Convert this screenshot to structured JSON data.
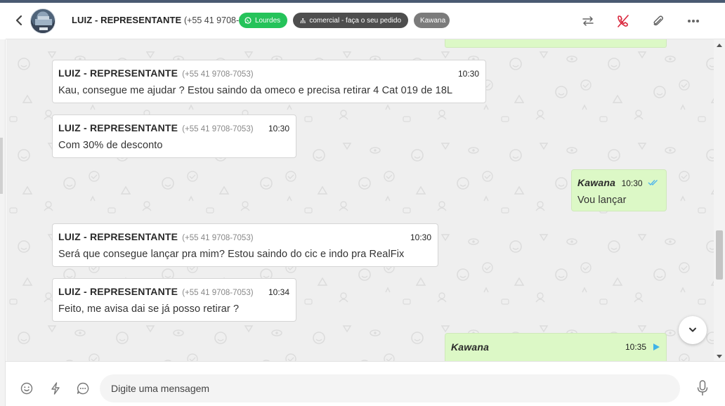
{
  "header": {
    "contact_name": "LUIZ - REPRESENTANTE",
    "contact_phone": "(+55 41 9708-7053)",
    "tags": [
      {
        "label": "Lourdes",
        "color": "#25c35a",
        "icon": "whatsapp-icon"
      },
      {
        "label": "comercial - faça o seu pedido",
        "color": "#4e4e4e",
        "icon": "sitemap-icon"
      },
      {
        "label": "Kawana",
        "color": "#7b7b7b"
      }
    ],
    "actions": [
      "transfer-icon",
      "end-call-icon",
      "paperclip-icon",
      "more-icon"
    ]
  },
  "messages": [
    {
      "direction": "in",
      "sender": "LUIZ - REPRESENTANTE",
      "phone": "(+55 41 9708-7053)",
      "time": "10:30",
      "text": "Kau, consegue me ajudar ? Estou saindo da omeco e precisa retirar 4 Cat 019 de 18L"
    },
    {
      "direction": "in",
      "sender": "LUIZ - REPRESENTANTE",
      "phone": "(+55 41 9708-7053)",
      "time": "10:30",
      "text": "Com 30% de desconto"
    },
    {
      "direction": "out",
      "sender": "Kawana",
      "time": "10:30",
      "text": "Vou lançar",
      "status": "read"
    },
    {
      "direction": "in",
      "sender": "LUIZ - REPRESENTANTE",
      "phone": "(+55 41 9708-7053)",
      "time": "10:30",
      "text": "Será que consegue lançar pra mim? Estou saindo do cic e indo pra RealFix"
    },
    {
      "direction": "in",
      "sender": "LUIZ - REPRESENTANTE",
      "phone": "(+55 41 9708-7053)",
      "time": "10:34",
      "text": "Feito, me avisa dai se já posso retirar ?"
    },
    {
      "direction": "out",
      "sender": "Kawana",
      "time": "10:35",
      "text": ""
    }
  ],
  "composer": {
    "placeholder": "Digite uma mensagem",
    "icons": [
      "emoji-icon",
      "lightning-icon",
      "chat-bubble-icon",
      "microphone-icon"
    ]
  },
  "colors": {
    "outgoing_bubble": "#dcf8c6",
    "incoming_bubble": "#ffffff",
    "chat_background": "#efefef",
    "read_ticks": "#4fb6ec"
  }
}
